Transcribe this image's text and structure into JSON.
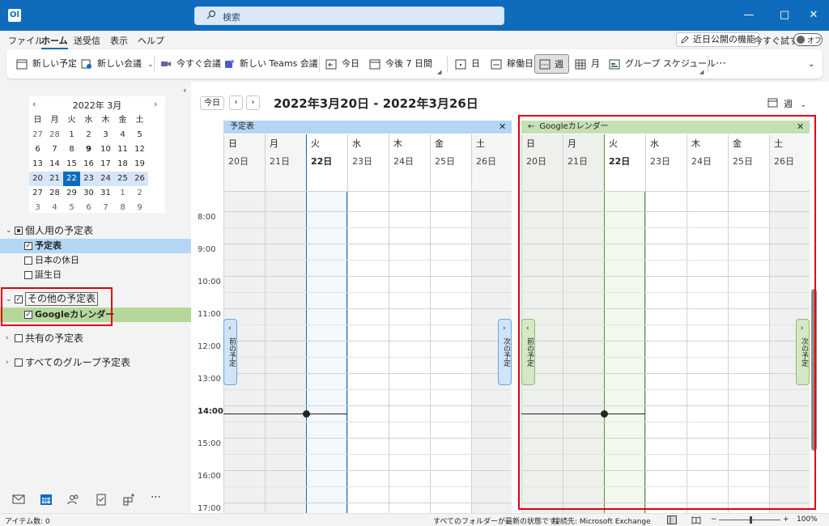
{
  "titlebar": {
    "app_icon": "Ol",
    "search_placeholder": "検索",
    "minimize": "—",
    "maximize": "□",
    "close": "✕"
  },
  "menu": {
    "items": [
      "ファイル",
      "ホーム",
      "送受信",
      "表示",
      "ヘルプ"
    ],
    "active": "ホーム",
    "feature_button": "近日公開の機能",
    "try_now": "今すぐ試す",
    "toggle": "オフ"
  },
  "ribbon": {
    "new_appointment": "新しい予定",
    "new_meeting": "新しい会議",
    "meet_now": "今すぐ会議",
    "new_teams": "新しい Teams 会議",
    "today": "今日",
    "next7": "今後 7 日間",
    "day": "日",
    "workweek": "稼働日",
    "week": "週",
    "month": "月",
    "group": "グループ スケジュール",
    "more": "⋯",
    "collapse": "⌄"
  },
  "mini_calendar": {
    "title": "2022年 3月",
    "weekdays": [
      "日",
      "月",
      "火",
      "水",
      "木",
      "金",
      "土"
    ],
    "weeks": [
      [
        "27",
        "28",
        "1",
        "2",
        "3",
        "4",
        "5"
      ],
      [
        "6",
        "7",
        "8",
        "9",
        "10",
        "11",
        "12"
      ],
      [
        "13",
        "14",
        "15",
        "16",
        "17",
        "18",
        "19"
      ],
      [
        "20",
        "21",
        "22",
        "23",
        "24",
        "25",
        "26"
      ],
      [
        "27",
        "28",
        "29",
        "30",
        "31",
        "1",
        "2"
      ],
      [
        "3",
        "4",
        "5",
        "6",
        "7",
        "8",
        "9"
      ]
    ]
  },
  "folders": {
    "personal": "個人用の予定表",
    "calendar": "予定表",
    "holidays": "日本の休日",
    "birthdays": "誕生日",
    "other": "その他の予定表",
    "google": "Googleカレンダー",
    "shared": "共有の予定表",
    "groups": "すべてのグループ予定表"
  },
  "toolbar": {
    "today": "今日",
    "prev": "‹",
    "next": "›",
    "range": "2022年3月20日 - 2022年3月26日",
    "view": "週"
  },
  "panels": [
    {
      "name": "予定表",
      "color": "#b3d6f5",
      "accent": "#0f6cbd"
    },
    {
      "name": "Googleカレンダー",
      "color": "#c5e0b3",
      "accent": "#5b8c3a"
    }
  ],
  "days": [
    {
      "name": "日",
      "date": "20日"
    },
    {
      "name": "月",
      "date": "21日"
    },
    {
      "name": "火",
      "date": "22日"
    },
    {
      "name": "水",
      "date": "23日"
    },
    {
      "name": "木",
      "date": "24日"
    },
    {
      "name": "金",
      "date": "25日"
    },
    {
      "name": "土",
      "date": "26日"
    }
  ],
  "hours": [
    "8:00",
    "9:00",
    "10:00",
    "11:00",
    "12:00",
    "13:00",
    "14:00",
    "15:00",
    "16:00",
    "17:00"
  ],
  "side_tabs": {
    "prev": "前の予定",
    "next": "次の予定"
  },
  "status": {
    "items": "アイテム数: 0",
    "folders": "すべてのフォルダーが最新の状態です。",
    "connection": "接続先: Microsoft Exchange",
    "zoom": "100%",
    "zoom_minus": "−",
    "zoom_plus": "+"
  }
}
